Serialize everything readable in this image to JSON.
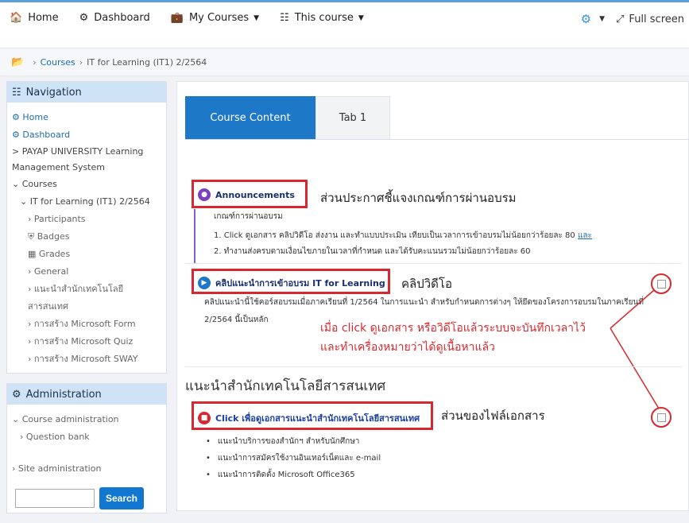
{
  "topnav": {
    "home": "Home",
    "dashboard": "Dashboard",
    "my_courses": "My Courses",
    "this_course": "This course",
    "fullscreen": "Full screen"
  },
  "breadcrumb": {
    "courses": "Courses",
    "current": "IT for Learning (IT1) 2/2564"
  },
  "navigation": {
    "title": "Navigation",
    "home": "Home",
    "dashboard": "Dashboard",
    "payap": "> PAYAP UNIVERSITY Learning Management System",
    "courses": "Courses",
    "course": "IT for Learning (IT1) 2/2564",
    "participants": "Participants",
    "badges": "Badges",
    "grades": "Grades",
    "general": "General",
    "intro": "แนะนำสำนักเทคโนโลยีสารสนเทศ",
    "form": "การสร้าง Microsoft Form",
    "quiz": "การสร้าง Microsoft Quiz",
    "sway": "การสร้าง Microsoft SWAY"
  },
  "admin": {
    "title": "Administration",
    "course_admin": "Course administration",
    "question_bank": "Question bank",
    "site_admin": "Site administration",
    "search_button": "Search",
    "search_placeholder": ""
  },
  "tabs": {
    "content": "Course Content",
    "tab1": "Tab 1"
  },
  "content": {
    "announcements": "Announcements",
    "announce_callout": "ส่วนประกาศชี้แจงเกณฑ์การผ่านอบรม",
    "criteria_title": "เกณฑ์การผ่านอบรม",
    "criteria_1": "1. Click ดูเอกสาร คลิปวิดีโอ ส่งงาน และทำแบบประเมิน เทียบเป็นเวลาการเข้าอบรมไม่น้อยกว่าร้อยละ 80",
    "criteria_1_link": "และ",
    "criteria_2": "2. ทำงานส่งครบตามเงื่อนไขภายในเวลาที่กำหนด และได้รับคะแนนรวมไม่น้อยกว่าร้อยละ 60",
    "video_link": "คลิปแนะนำการเข้าอบรม IT for Learning",
    "video_callout": "คลิปวิดีโอ",
    "video_desc_1": "คลิปแนะนำนี้ใช้คอร์สอบรมเมื่อภาคเรียนที่ 1/2564 ในการแนะนำ สำหรับกำหนดการต่างๆ ให้ยึดของโครงการอบรมในภาคเรียนที่",
    "video_desc_2": "2/2564 นี้เป็นหลัก",
    "red_note_1": "เมื่อ click ดูเอกสาร หรือวิดีโอแล้วระบบจะบันทึกเวลาไว้",
    "red_note_2": "และทำเครื่องหมายว่าได้ดูเนื้อหาแล้ว",
    "section_title": "แนะนำสำนักเทคโนโลยีสารสนเทศ",
    "doc_link": "Click เพื่อดูเอกสารแนะนำสำนักเทคโนโลยีสารสนเทศ",
    "doc_callout": "ส่วนของไฟล์เอกสาร",
    "bullets": [
      "แนะนำบริการของสำนักฯ สำหรับนักศึกษา",
      "แนะนำการสมัครใช้งานอินเทอร์เน็ตและ e-mail",
      "แนะนำการติดตั้ง Microsoft Office365"
    ]
  },
  "colors": {
    "accent": "#1d78c8",
    "highlight_red": "#d7282f"
  }
}
